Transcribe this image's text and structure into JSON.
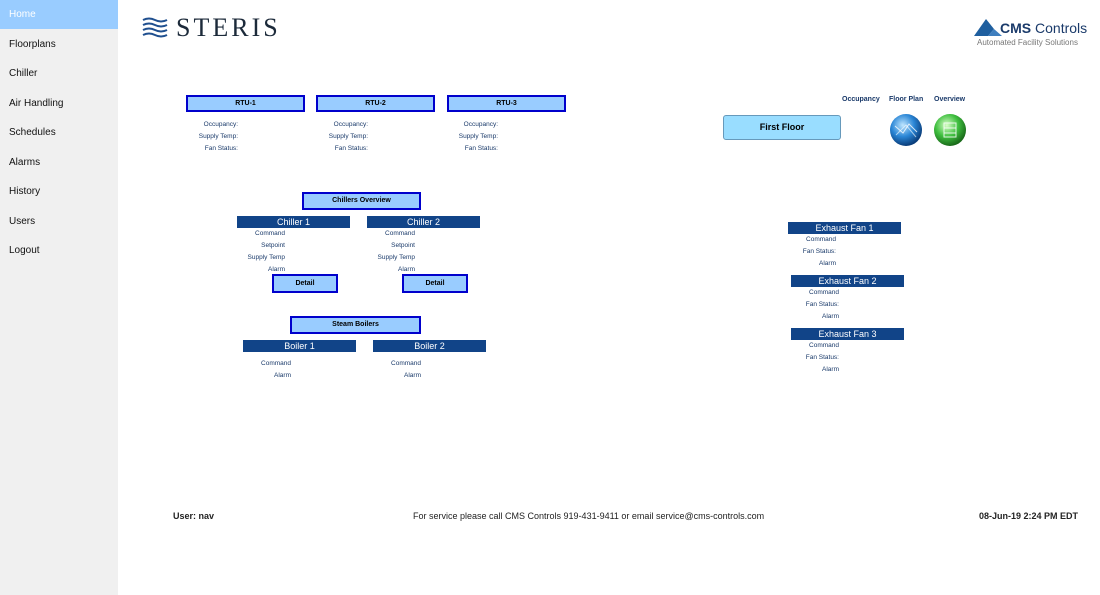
{
  "nav": {
    "items": [
      {
        "label": "Home",
        "active": true
      },
      {
        "label": "Floorplans"
      },
      {
        "label": "Chiller"
      },
      {
        "label": "Air Handling"
      },
      {
        "label": "Schedules"
      },
      {
        "label": "Alarms"
      },
      {
        "label": "History"
      },
      {
        "label": "Users"
      },
      {
        "label": "Logout"
      }
    ]
  },
  "header": {
    "logo_left": "STERIS",
    "logo_right_brand": "CMS",
    "logo_right_name": "Controls",
    "logo_right_tagline": "Automated Facility Solutions"
  },
  "rtus": [
    {
      "title": "RTU-1",
      "occupancy_label": "Occupancy:",
      "supply_temp_label": "Supply Temp:",
      "fan_status_label": "Fan Status:"
    },
    {
      "title": "RTU-2",
      "occupancy_label": "Occupancy:",
      "supply_temp_label": "Supply Temp:",
      "fan_status_label": "Fan Status:"
    },
    {
      "title": "RTU-3",
      "occupancy_label": "Occupancy:",
      "supply_temp_label": "Supply Temp:",
      "fan_status_label": "Fan Status:"
    }
  ],
  "links": {
    "occupancy": "Occupancy",
    "floor_plan": "Floor Plan",
    "overview": "Overview",
    "first_floor": "First Floor"
  },
  "chillers": {
    "overview_label": "Chillers Overview",
    "units": [
      {
        "title": "Chiller 1",
        "command": "Command",
        "setpoint": "Setpoint",
        "supply_temp": "Supply Temp",
        "alarm": "Alarm",
        "detail": "Detail"
      },
      {
        "title": "Chiller 2",
        "command": "Command",
        "setpoint": "Setpoint",
        "supply_temp": "Supply Temp",
        "alarm": "Alarm",
        "detail": "Detail"
      }
    ]
  },
  "boilers": {
    "overview_label": "Steam Boilers",
    "units": [
      {
        "title": "Boiler 1",
        "command": "Command",
        "alarm": "Alarm"
      },
      {
        "title": "Boiler 2",
        "command": "Command",
        "alarm": "Alarm"
      }
    ]
  },
  "exhaust_fans": [
    {
      "title": "Exhaust Fan 1",
      "command": "Command",
      "fan_status": "Fan Status:",
      "alarm": "Alarm"
    },
    {
      "title": "Exhaust Fan 2",
      "command": "Command",
      "fan_status": "Fan Status:",
      "alarm": "Alarm"
    },
    {
      "title": "Exhaust Fan 3",
      "command": "Command",
      "fan_status": "Fan Status:",
      "alarm": "Alarm"
    }
  ],
  "footer": {
    "user": "User: nav",
    "service": "For service please call CMS Controls 919-431-9411   or email service@cms-controls.com",
    "datetime": "08-Jun-19 2:24 PM EDT"
  },
  "colors": {
    "sidebar_bg": "#f0f0f0",
    "active_nav": "#99ccff",
    "button_fill": "#99ccff",
    "button_border": "#0000cc",
    "dark_bar": "#114488",
    "label_text": "#1a3a6a"
  }
}
